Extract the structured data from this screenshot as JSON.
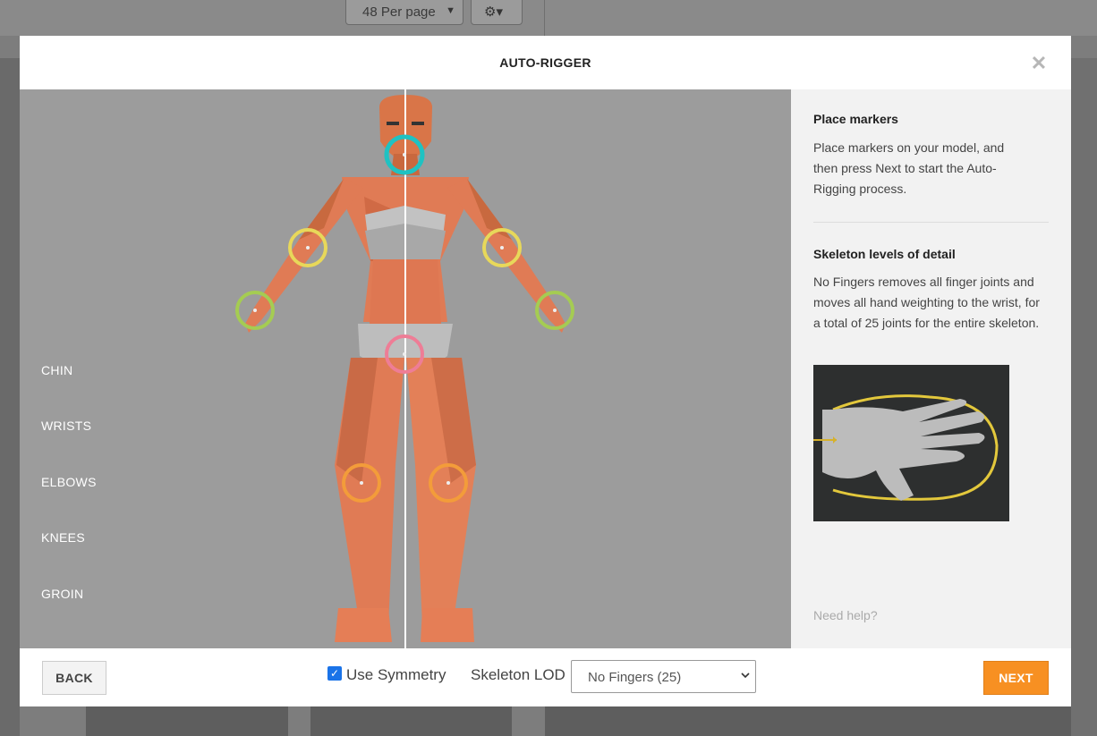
{
  "background": {
    "per_page_select": "48 Per page",
    "settings_icon": "gear-icon"
  },
  "modal": {
    "title": "AUTO-RIGGER",
    "close_icon": "close-icon"
  },
  "viewport": {
    "marker_labels": [
      "CHIN",
      "WRISTS",
      "ELBOWS",
      "KNEES",
      "GROIN"
    ],
    "marker_colors": {
      "chin": "#1fc2c2",
      "elbows": "#e8d85a",
      "wrists": "#a5cc52",
      "groin": "#ee7d96",
      "knees": "#f39c3a"
    },
    "model_color": "#e07b55"
  },
  "sidebar": {
    "section1_title": "Place markers",
    "section1_text": "Place markers on your model, and then press Next to start the Auto-Rigging process.",
    "section2_title": "Skeleton levels of detail",
    "section2_text": "No Fingers removes all finger joints and moves all hand weighting to the wrist, for a total of 25 joints for the entire skeleton.",
    "help_link": "Need help?"
  },
  "footer": {
    "back_label": "BACK",
    "symmetry_label": "Use Symmetry",
    "symmetry_checked": true,
    "lod_label": "Skeleton LOD",
    "lod_value": "No Fingers (25)",
    "next_label": "NEXT"
  },
  "colors": {
    "accent": "#f79022",
    "checkbox": "#1a73e8"
  }
}
